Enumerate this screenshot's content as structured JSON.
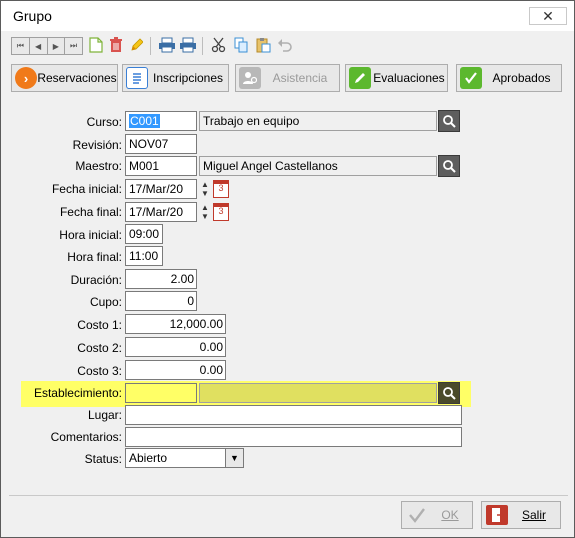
{
  "window": {
    "title": "Grupo",
    "close_label": "✕"
  },
  "toolbar": {
    "nav": [
      "⏮",
      "◀",
      "▶",
      "⏭"
    ],
    "icons": [
      "new-doc-icon",
      "delete-icon",
      "edit-icon",
      "print-icon",
      "print-preview-icon",
      "cut-icon",
      "copy-icon",
      "paste-icon",
      "undo-icon"
    ]
  },
  "actions": {
    "reservaciones": "Reservaciones",
    "inscripciones": "Inscripciones",
    "asistencia": "Asistencia",
    "evaluaciones": "Evaluaciones",
    "aprobados": "Aprobados"
  },
  "form": {
    "curso": {
      "label": "Curso:",
      "code": "C001",
      "name": "Trabajo en equipo"
    },
    "revision": {
      "label": "Revisión:",
      "value": "NOV07"
    },
    "maestro": {
      "label": "Maestro:",
      "code": "M001",
      "name": "Miguel Angel Castellanos"
    },
    "fecha_inicial": {
      "label": "Fecha inicial:",
      "value": "17/Mar/20"
    },
    "fecha_final": {
      "label": "Fecha final:",
      "value": "17/Mar/20"
    },
    "hora_inicial": {
      "label": "Hora inicial:",
      "value": "09:00"
    },
    "hora_final": {
      "label": "Hora final:",
      "value": "11:00"
    },
    "duracion": {
      "label": "Duración:",
      "value": "2.00"
    },
    "cupo": {
      "label": "Cupo:",
      "value": "0"
    },
    "costo1": {
      "label": "Costo 1:",
      "value": "12,000.00"
    },
    "costo2": {
      "label": "Costo 2:",
      "value": "0.00"
    },
    "costo3": {
      "label": "Costo 3:",
      "value": "0.00"
    },
    "establecimiento": {
      "label": "Establecimiento:",
      "code": "",
      "name": ""
    },
    "lugar": {
      "label": "Lugar:",
      "value": ""
    },
    "comentarios": {
      "label": "Comentarios:",
      "value": ""
    },
    "status": {
      "label": "Status:",
      "value": "Abierto"
    },
    "calendar_day": "3"
  },
  "footer": {
    "ok": "OK",
    "salir": "Salir"
  },
  "colors": {
    "highlight": "#ffff66",
    "accent_orange": "#f07a1a",
    "accent_green": "#5cb82e",
    "accent_blue": "#3a7fd5",
    "salir_red": "#c0392b"
  }
}
